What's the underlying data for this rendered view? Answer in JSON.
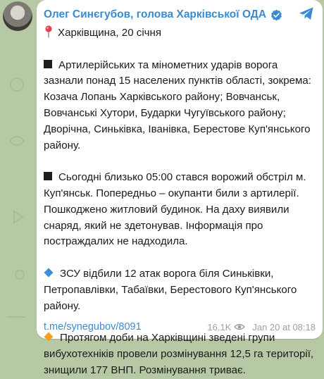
{
  "channel": {
    "name": "Олег Синєгубов, голова Харківської ОДА"
  },
  "post": {
    "location": "Харківщина, 20 січня",
    "paragraphs": [
      {
        "marker": "black-square",
        "lines": [
          "Артилерійських та мінометних ударів ворога",
          "зазнали понад 15 населених пунктів області, зокрема:",
          "Козача Лопань Харківського району; Вовчанськ,",
          "Вовчанські Хутори, Бударки Чугуївського району;",
          "Дворічна, Синьківка, Іванівка, Берестове Куп'янського",
          "району."
        ]
      },
      {
        "marker": "black-square",
        "lines": [
          "Сьогодні близько 05:00 стався ворожий обстріл м.",
          "Куп'янськ. Попередньо – окупанти били з артилерії.",
          "Пошкоджено житловий будинок. На даху виявили",
          "снаряд, який не здетонував. Інформація про",
          "постраждалих не надходила."
        ]
      },
      {
        "marker": "blue-diamond",
        "lines": [
          "ЗСУ відбили 12 атак ворога біля Синьківки,",
          "Петропавлівки, Табаївки, Берестового Куп'янського",
          "району."
        ]
      },
      {
        "marker": "orange-diamond",
        "lines": [
          "Протягом доби на Харківщині зведені групи",
          "вибухотехніків провели розмінування 12,5 га території,",
          "знищили 177 ВНП. Розмінування триває."
        ]
      }
    ]
  },
  "footer": {
    "link": "t.me/synegubov/8091",
    "views": "16.1K",
    "date": "Jan 20 at 08:18"
  },
  "colors": {
    "accent": "#3a8bd1",
    "background": "#b7c8a4",
    "orange": "#f4a21e",
    "blue": "#3b8fd9"
  },
  "icons": [
    "avatar",
    "verified-badge-icon",
    "telegram-share-icon",
    "pin-icon",
    "black-square-icon",
    "blue-diamond-icon",
    "orange-diamond-icon",
    "eye-icon"
  ]
}
